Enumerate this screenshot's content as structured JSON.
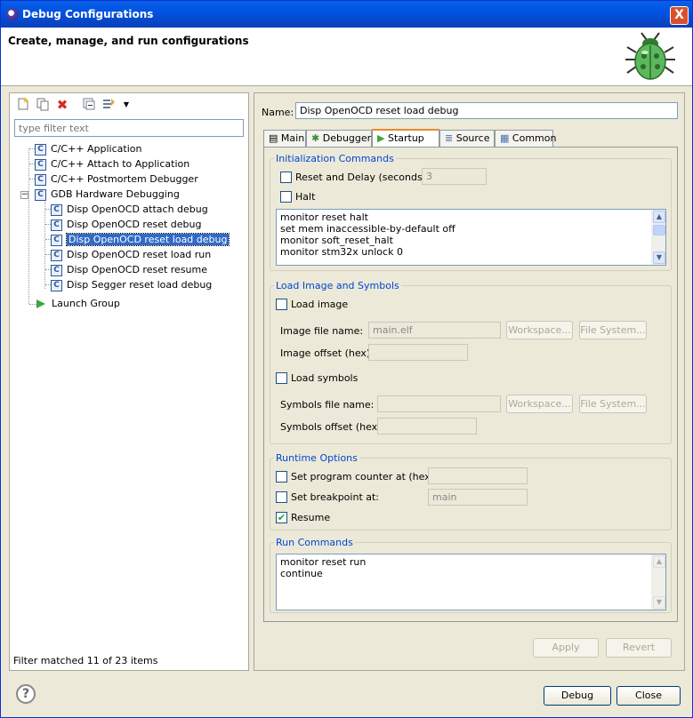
{
  "window": {
    "title": "Debug Configurations",
    "close_glyph": "X"
  },
  "header": {
    "text": "Create, manage, and run configurations"
  },
  "left": {
    "toolbar": [
      "new-config-icon",
      "duplicate-icon",
      "delete-icon",
      "collapse-all-icon",
      "filter-icon"
    ],
    "filter_placeholder": "type filter text",
    "tree": [
      {
        "label": "C/C++ Application"
      },
      {
        "label": "C/C++ Attach to Application"
      },
      {
        "label": "C/C++ Postmortem Debugger"
      },
      {
        "label": "GDB Hardware Debugging"
      },
      {
        "label": "Disp OpenOCD attach debug"
      },
      {
        "label": "Disp OpenOCD reset debug"
      },
      {
        "label": "Disp OpenOCD reset load debug"
      },
      {
        "label": "Disp OpenOCD reset load run"
      },
      {
        "label": "Disp OpenOCD reset resume"
      },
      {
        "label": "Disp Segger reset load debug"
      },
      {
        "label": "Launch Group"
      }
    ],
    "filter_message": "Filter matched 11 of 23 items"
  },
  "right": {
    "name_label": "Name:",
    "name_value": "Disp OpenOCD reset load debug",
    "tabs": [
      "Main",
      "Debugger",
      "Startup",
      "Source",
      "Common"
    ],
    "init": {
      "group": "Initialization Commands",
      "reset_delay_label": "Reset and Delay (seconds):",
      "reset_delay_value": "3",
      "halt_label": "Halt",
      "commands": [
        "monitor reset halt",
        "set mem inaccessible-by-default off",
        "monitor soft_reset_halt",
        "monitor stm32x unlock 0"
      ]
    },
    "load": {
      "group": "Load Image and Symbols",
      "load_image_label": "Load image",
      "image_file_label": "Image file name:",
      "image_file_value": "main.elf",
      "workspace": "Workspace...",
      "filesystem": "File System...",
      "image_offset_label": "Image offset (hex):",
      "load_symbols_label": "Load symbols",
      "symbols_file_label": "Symbols file name:",
      "symbols_offset_label": "Symbols offset (hex):"
    },
    "runtime": {
      "group": "Runtime Options",
      "set_pc_label": "Set program counter at (hex):",
      "set_bp_label": "Set breakpoint at:",
      "bp_value": "main",
      "resume_label": "Resume",
      "resume_checked": true
    },
    "run": {
      "group": "Run Commands",
      "commands": [
        "monitor reset run",
        "continue"
      ]
    },
    "apply": "Apply",
    "revert": "Revert"
  },
  "footer": {
    "debug": "Debug",
    "close": "Close",
    "help": "?"
  }
}
